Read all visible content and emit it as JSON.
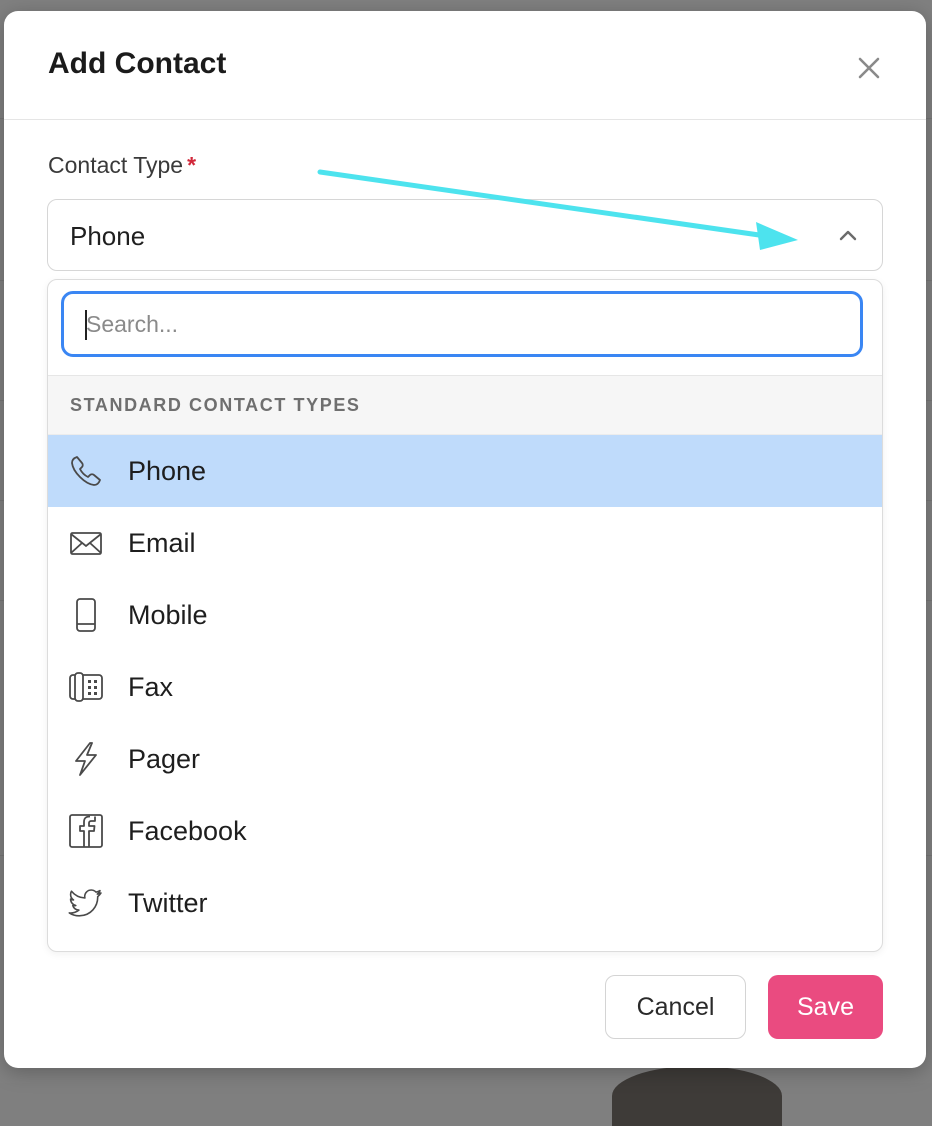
{
  "modal": {
    "title": "Add Contact",
    "close_icon": "close-icon"
  },
  "contact_type": {
    "label": "Contact Type",
    "required_marker": "*",
    "selected_value": "Phone",
    "chevron_icon": "chevron-up-icon"
  },
  "dropdown": {
    "search_placeholder": "Search...",
    "search_value": "",
    "group_label": "STANDARD CONTACT TYPES",
    "selected_index": 0,
    "options": [
      {
        "label": "Phone",
        "icon": "phone-icon"
      },
      {
        "label": "Email",
        "icon": "envelope-icon"
      },
      {
        "label": "Mobile",
        "icon": "mobile-icon"
      },
      {
        "label": "Fax",
        "icon": "fax-icon"
      },
      {
        "label": "Pager",
        "icon": "lightning-icon"
      },
      {
        "label": "Facebook",
        "icon": "facebook-icon"
      },
      {
        "label": "Twitter",
        "icon": "twitter-icon"
      }
    ]
  },
  "footer": {
    "cancel_label": "Cancel",
    "save_label": "Save"
  },
  "colors": {
    "accent": "#ea4b80",
    "focus_ring": "#3a86f3",
    "selected_row": "#bfdbfb",
    "annotation_arrow": "#4de3ee",
    "required": "#d1283a"
  }
}
